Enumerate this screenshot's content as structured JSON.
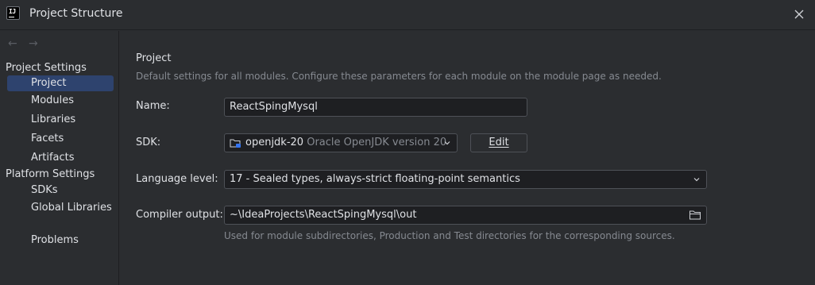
{
  "window": {
    "title": "Project Structure",
    "logo_text": "IJ"
  },
  "sidebar": {
    "sections": [
      {
        "label": "Project Settings",
        "items": [
          "Project",
          "Modules",
          "Libraries",
          "Facets",
          "Artifacts"
        ]
      },
      {
        "label": "Platform Settings",
        "items": [
          "SDKs",
          "Global Libraries"
        ]
      }
    ],
    "problems": "Problems",
    "selected": "Project"
  },
  "main": {
    "title": "Project",
    "description": "Default settings for all modules. Configure these parameters for each module on the module page as needed.",
    "name_label": "Name:",
    "name_value": "ReactSpingMysql",
    "sdk_label": "SDK:",
    "sdk_name": "openjdk-20",
    "sdk_detail": "Oracle OpenJDK version 20",
    "edit_button": "Edit",
    "language_label": "Language level:",
    "language_value": "17 - Sealed types, always-strict floating-point semantics",
    "compiler_label": "Compiler output:",
    "compiler_value": "~\\IdeaProjects\\ReactSpingMysql\\out",
    "compiler_hint": "Used for module subdirectories, Production and Test directories for the corresponding sources."
  },
  "colors": {
    "accent_selection": "#2e436e",
    "background": "#2b2d30",
    "field_bg": "#1e1f22"
  }
}
